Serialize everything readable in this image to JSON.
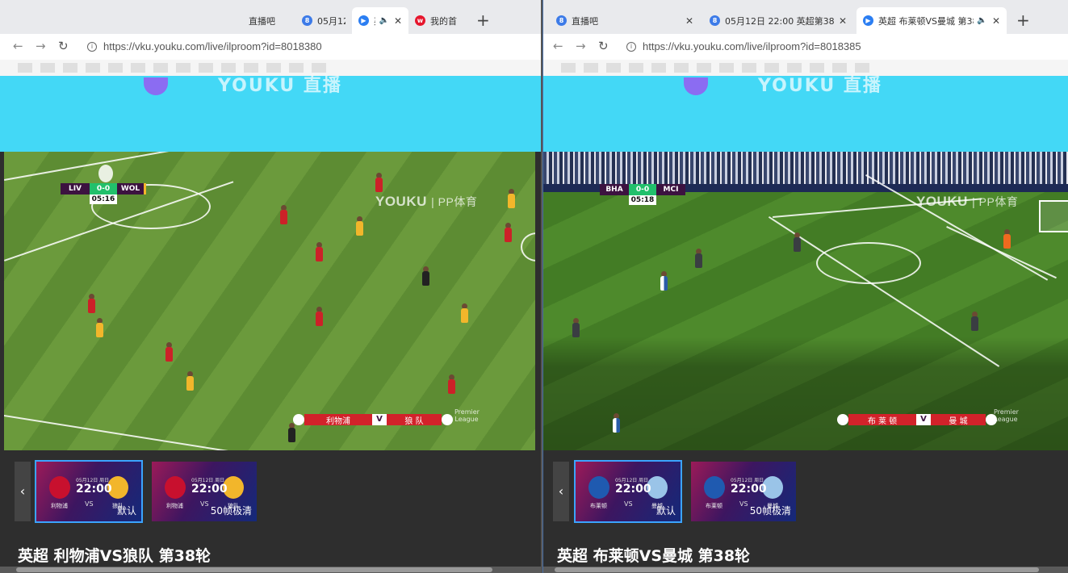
{
  "left": {
    "tabs": [
      {
        "label": "直播吧"
      },
      {
        "label": "05月12"
      },
      {
        "label": "英"
      },
      {
        "label": "我的首"
      }
    ],
    "url": "https://vku.youku.com/live/ilproom?id=8018380",
    "banner_text": "YOUKU 直播",
    "scoreboard": {
      "home": "LIV",
      "score": "0-0",
      "away": "WOL",
      "time": "05:16"
    },
    "watermark": {
      "brand": "YOUKU",
      "sub": "| PP体育"
    },
    "lower_third": {
      "home": "利物浦",
      "vs": "V",
      "away": "狼 队"
    },
    "league_logo": "Premier League",
    "thumbnails": [
      {
        "date": "05月12日 周日",
        "time": "22:00",
        "vs": "VS",
        "home": "利物浦",
        "away": "狼队",
        "quality": "默认"
      },
      {
        "date": "05月12日 周日",
        "time": "22:00",
        "vs": "VS",
        "home": "利物浦",
        "away": "狼队",
        "quality": "50帧极清"
      }
    ],
    "title": "英超 利物浦VS狼队 第38轮"
  },
  "right": {
    "tabs": [
      {
        "label": "直播吧"
      },
      {
        "label": "05月12日 22:00 英超第38轮"
      },
      {
        "label": "英超 布莱顿VS曼城 第38"
      }
    ],
    "url": "https://vku.youku.com/live/ilproom?id=8018385",
    "banner_text": "YOUKU 直播",
    "scoreboard": {
      "home": "BHA",
      "score": "0-0",
      "away": "MCI",
      "time": "05:18"
    },
    "watermark": {
      "brand": "YOUKU",
      "sub": "| PP体育"
    },
    "lower_third": {
      "home": "布 莱 顿",
      "vs": "V",
      "away": "曼 城"
    },
    "league_logo": "Premier League",
    "thumbnails": [
      {
        "date": "05月12日 周日",
        "time": "22:00",
        "vs": "VS",
        "home": "布莱顿",
        "away": "曼城",
        "quality": "默认"
      },
      {
        "date": "05月12日 周日",
        "time": "22:00",
        "vs": "VS",
        "home": "布莱顿",
        "away": "曼城",
        "quality": "50帧极清"
      }
    ],
    "title": "英超 布莱顿VS曼城 第38轮"
  },
  "icons": {
    "back": "←",
    "forward": "→",
    "reload": "↻",
    "close": "✕",
    "new_tab": "+",
    "speaker": "🔈",
    "prev": "‹"
  },
  "colors": {
    "banner": "#43d8f6",
    "live_red": "#d2222a",
    "score_green": "#21c06b",
    "select_blue": "#3ba4ff"
  }
}
